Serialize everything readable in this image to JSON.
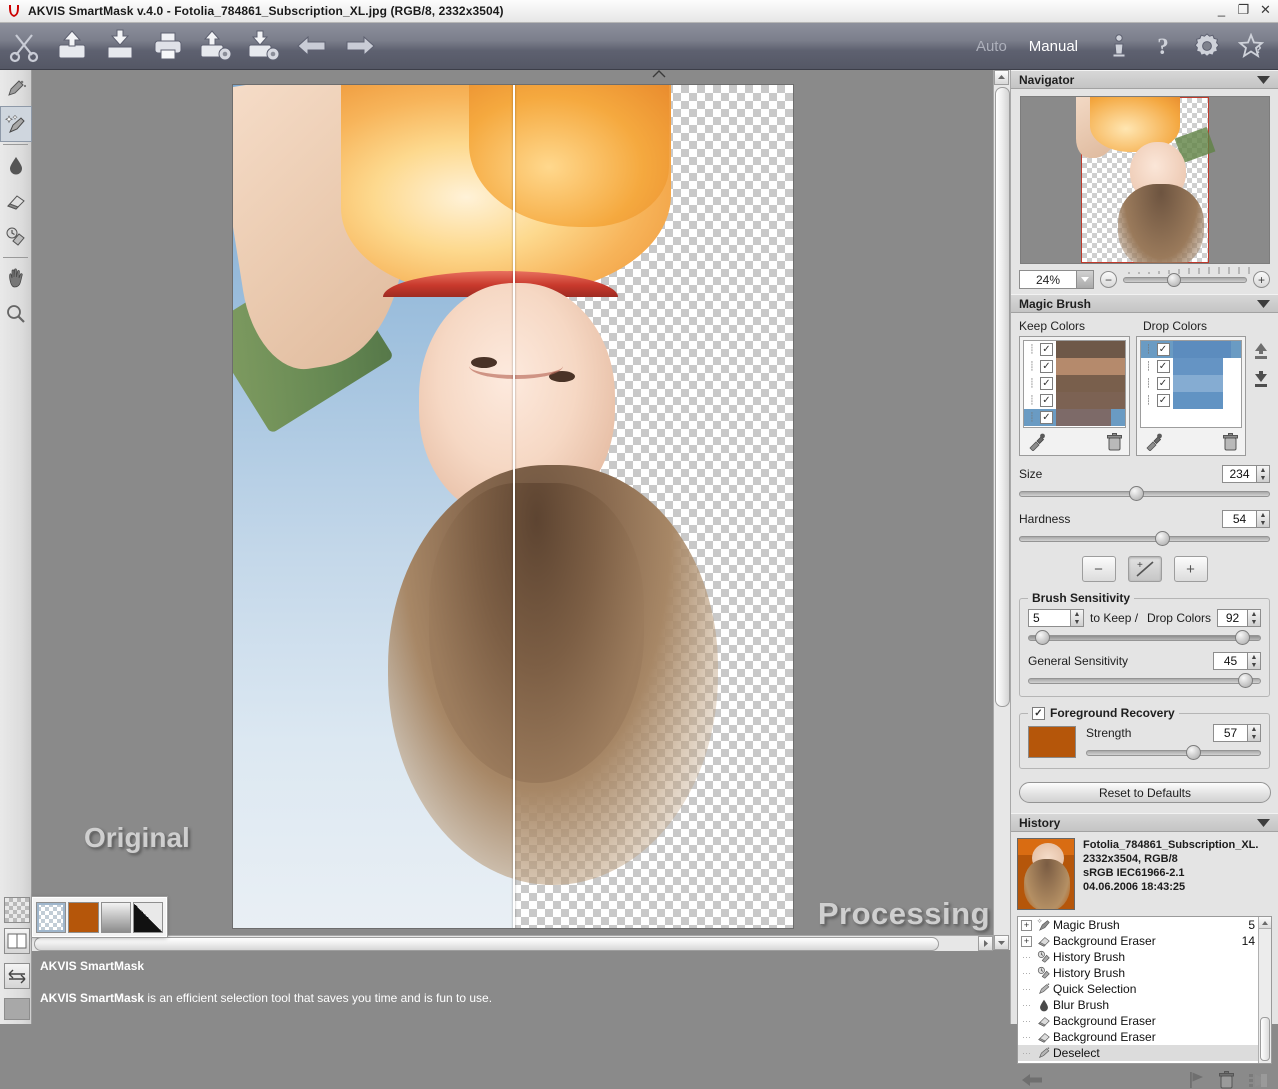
{
  "window": {
    "title": "AKVIS SmartMask v.4.0 - Fotolia_784861_Subscription_XL.jpg (RGB/8, 2332x3504)",
    "minimize": "_",
    "maximize": "❐",
    "close": "✕"
  },
  "toolbar": {
    "items": [
      {
        "name": "scissors-logo-icon",
        "label": "Scissors"
      },
      {
        "name": "open-image-icon",
        "label": "Open Image"
      },
      {
        "name": "save-image-icon",
        "label": "Save Image"
      },
      {
        "name": "print-icon",
        "label": "Print Image"
      },
      {
        "name": "import-settings-icon",
        "label": "Import Settings"
      },
      {
        "name": "export-settings-icon",
        "label": "Export Settings"
      },
      {
        "name": "undo-icon",
        "label": "Undo"
      },
      {
        "name": "redo-icon",
        "label": "Redo"
      }
    ],
    "modes": [
      {
        "label": "Auto",
        "active": false
      },
      {
        "label": "Manual",
        "active": true
      }
    ],
    "right_icons": [
      {
        "name": "info-icon",
        "label": "About"
      },
      {
        "name": "help-icon",
        "label": "Help"
      },
      {
        "name": "settings-gear-icon",
        "label": "Preferences"
      },
      {
        "name": "favorites-star-icon",
        "label": "Favorites"
      }
    ]
  },
  "left_tools": [
    {
      "name": "quick-selection-tool",
      "label": "Quick Selection",
      "selected": false
    },
    {
      "name": "magic-brush-tool",
      "label": "Magic Brush",
      "selected": true
    },
    {
      "name": "blur-brush-tool",
      "label": "Blur Brush",
      "selected": false
    },
    {
      "name": "background-eraser-tool",
      "label": "Background Eraser",
      "selected": false
    },
    {
      "name": "history-brush-tool",
      "label": "History Brush",
      "selected": false
    },
    {
      "name": "hand-tool",
      "label": "Hand",
      "selected": false
    },
    {
      "name": "zoom-tool",
      "label": "Zoom",
      "selected": false
    }
  ],
  "canvas": {
    "original_label": "Original",
    "processing_label": "Processing"
  },
  "background_popup": {
    "options": [
      {
        "name": "bg-transparent",
        "label": "Transparent",
        "selected": true
      },
      {
        "name": "bg-orange",
        "label": "Orange",
        "color": "#b5560a",
        "selected": false
      },
      {
        "name": "bg-gradient",
        "label": "Gradient",
        "selected": false
      },
      {
        "name": "bg-blackwhite",
        "label": "Black and White",
        "selected": false
      }
    ]
  },
  "navigator": {
    "title": "Navigator",
    "zoom_value": "24%",
    "zoom_out": "−",
    "zoom_in": "+"
  },
  "magic_brush": {
    "title": "Magic Brush",
    "keep_colors": {
      "label": "Keep Colors",
      "swatches": [
        {
          "color": "#6e5848",
          "checked": true,
          "selected": false
        },
        {
          "color": "#b58a6c",
          "checked": true,
          "selected": false
        },
        {
          "color": "#795f4c",
          "checked": true,
          "selected": false
        },
        {
          "color": "#7c6253",
          "checked": true,
          "selected": false
        },
        {
          "color": "#7d6a68",
          "checked": true,
          "selected": true
        }
      ],
      "pick_tool": "eyedropper-icon",
      "delete_tool": "trash-icon"
    },
    "drop_colors": {
      "label": "Drop Colors",
      "swatches": [
        {
          "color": "#5c8cbe",
          "checked": true,
          "selected": true
        },
        {
          "color": "#6594c4",
          "checked": true,
          "selected": false
        },
        {
          "color": "#85acd2",
          "checked": true,
          "selected": false
        },
        {
          "color": "#6193c3",
          "checked": true,
          "selected": false
        }
      ],
      "pick_tool": "eyedropper-icon",
      "delete_tool": "trash-icon"
    },
    "size": {
      "label": "Size",
      "value": "234",
      "percent": 44
    },
    "hardness": {
      "label": "Hardness",
      "value": "54",
      "percent": 54
    },
    "mode_buttons": [
      {
        "name": "minus-mode-button",
        "label": "−",
        "selected": false
      },
      {
        "name": "plusminus-mode-button",
        "label": "±",
        "selected": true
      },
      {
        "name": "plus-mode-button",
        "label": "+",
        "selected": false
      }
    ],
    "brush_sensitivity": {
      "legend": "Brush Sensitivity",
      "keep_value": "5",
      "keep_label": "to Keep  /",
      "drop_label": "Drop Colors",
      "drop_value": "92",
      "keep_percent": 5,
      "drop_percent": 92,
      "general_label": "General Sensitivity",
      "general_value": "45",
      "general_percent": 92
    },
    "foreground_recovery": {
      "legend": "Foreground Recovery",
      "checked": true,
      "color": "#b5560a",
      "strength_label": "Strength",
      "strength_value": "57",
      "strength_percent": 57
    },
    "reset_button": "Reset to Defaults"
  },
  "history": {
    "title": "History",
    "file_info": [
      "Fotolia_784861_Subscription_XL.",
      "2332x3504, RGB/8",
      "sRGB IEC61966-2.1",
      "04.06.2006 18:43:25"
    ],
    "entries": [
      {
        "label": "Magic Brush",
        "count": "5",
        "icon": "magic-brush-icon",
        "expandable": true,
        "selected": false
      },
      {
        "label": "Background Eraser",
        "count": "14",
        "icon": "eraser-icon",
        "expandable": true,
        "selected": false
      },
      {
        "label": "History Brush",
        "count": "",
        "icon": "history-brush-icon",
        "expandable": false,
        "selected": false
      },
      {
        "label": "History Brush",
        "count": "",
        "icon": "history-brush-icon",
        "expandable": false,
        "selected": false
      },
      {
        "label": "Quick Selection",
        "count": "",
        "icon": "quick-selection-icon",
        "expandable": false,
        "selected": false
      },
      {
        "label": "Blur Brush",
        "count": "",
        "icon": "blur-brush-icon",
        "expandable": false,
        "selected": false
      },
      {
        "label": "Background Eraser",
        "count": "",
        "icon": "eraser-icon",
        "expandable": false,
        "selected": false
      },
      {
        "label": "Background Eraser",
        "count": "",
        "icon": "eraser-icon",
        "expandable": false,
        "selected": false
      },
      {
        "label": "Deselect",
        "count": "",
        "icon": "quick-selection-icon",
        "expandable": false,
        "selected": true
      }
    ],
    "footer_icons": [
      {
        "name": "history-back-button",
        "label": "Step Back"
      },
      {
        "name": "history-snapshot-flag-button",
        "label": "Set Marker"
      },
      {
        "name": "history-delete-button",
        "label": "Delete"
      },
      {
        "name": "history-clear-button",
        "label": "Clear History"
      }
    ]
  },
  "status": {
    "line1": "AKVIS SmartMask",
    "line2_bold": "AKVIS SmartMask",
    "line2_rest": " is an efficient selection tool that saves you time and is fun to use."
  }
}
